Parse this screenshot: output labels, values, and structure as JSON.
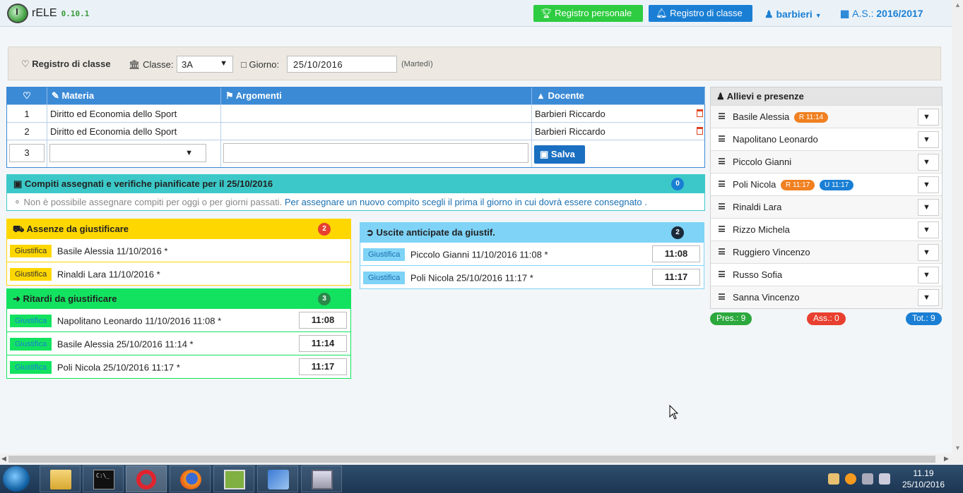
{
  "navbar": {
    "brand": "rELE",
    "version": "0.10.1",
    "btn_personale": "Registro personale",
    "btn_classe": "Registro di classe",
    "user": "barbieri",
    "year_label": "A.S.:",
    "year_value": "2016/2017"
  },
  "toolbar": {
    "title": "Registro di classe",
    "classe_label": "Classe:",
    "classe_value": "3A",
    "giorno_label": "Giorno:",
    "giorno_value": "25/10/2016",
    "day_name": "(Martedì)"
  },
  "lessons": {
    "headers": {
      "materia": "Materia",
      "argomenti": "Argomenti",
      "docente": "Docente"
    },
    "rows": [
      {
        "num": "1",
        "materia": "Diritto ed Economia dello Sport",
        "argomenti": "",
        "docente": "Barbieri Riccardo"
      },
      {
        "num": "2",
        "materia": "Diritto ed Economia dello Sport",
        "argomenti": "",
        "docente": "Barbieri Riccardo"
      }
    ],
    "new_row": {
      "num_value": "3",
      "save_label": "Salva"
    }
  },
  "compiti": {
    "title": "Compiti assegnati e verifiche pianificate per il 25/10/2016",
    "count": "0",
    "note": "Non è possibile assegnare compiti per oggi o per giorni passati.",
    "link": "Per assegnare un nuovo compito scegli il prima il giorno in cui dovrà essere consegnato ."
  },
  "assenze": {
    "title": "Assenze da giustificare",
    "count": "2",
    "items": [
      {
        "btn": "Giustifica",
        "text": "Basile Alessia 11/10/2016 *"
      },
      {
        "btn": "Giustifica",
        "text": "Rinaldi Lara 11/10/2016 *"
      }
    ]
  },
  "ritardi": {
    "title": "Ritardi da giustificare",
    "count": "3",
    "items": [
      {
        "btn": "Giustifica",
        "text": "Napolitano Leonardo 11/10/2016 11:08 *",
        "time": "11:08"
      },
      {
        "btn": "Giustifica",
        "text": "Basile Alessia 25/10/2016 11:14 *",
        "time": "11:14"
      },
      {
        "btn": "Giustifica",
        "text": "Poli Nicola 25/10/2016 11:17 *",
        "time": "11:17"
      }
    ]
  },
  "uscite": {
    "title": "Uscite anticipate da giustif.",
    "count": "2",
    "items": [
      {
        "btn": "Giustifica",
        "text": "Piccolo Gianni 11/10/2016 11:08 *",
        "time": "11:08"
      },
      {
        "btn": "Giustifica",
        "text": "Poli Nicola 25/10/2016 11:17 *",
        "time": "11:17"
      }
    ]
  },
  "students": {
    "title": "Allievi e presenze",
    "list": [
      {
        "name": "Basile Alessia",
        "r": "R 11:14",
        "u": ""
      },
      {
        "name": "Napolitano Leonardo",
        "r": "",
        "u": ""
      },
      {
        "name": "Piccolo Gianni",
        "r": "",
        "u": ""
      },
      {
        "name": "Poli Nicola",
        "r": "R 11:17",
        "u": "U 11:17"
      },
      {
        "name": "Rinaldi Lara",
        "r": "",
        "u": ""
      },
      {
        "name": "Rizzo Michela",
        "r": "",
        "u": ""
      },
      {
        "name": "Ruggiero Vincenzo",
        "r": "",
        "u": ""
      },
      {
        "name": "Russo Sofia",
        "r": "",
        "u": ""
      },
      {
        "name": "Sanna Vincenzo",
        "r": "",
        "u": ""
      }
    ],
    "pres": "Pres.: 9",
    "ass": "Ass.: 0",
    "tot": "Tot.: 9"
  },
  "taskbar": {
    "time": "11.19",
    "date": "25/10/2016"
  },
  "colors": {
    "primary": "#1a7fd4",
    "success": "#2ecc40",
    "warning": "#ffd700",
    "info": "#7ed3f7",
    "danger": "#e84030"
  }
}
